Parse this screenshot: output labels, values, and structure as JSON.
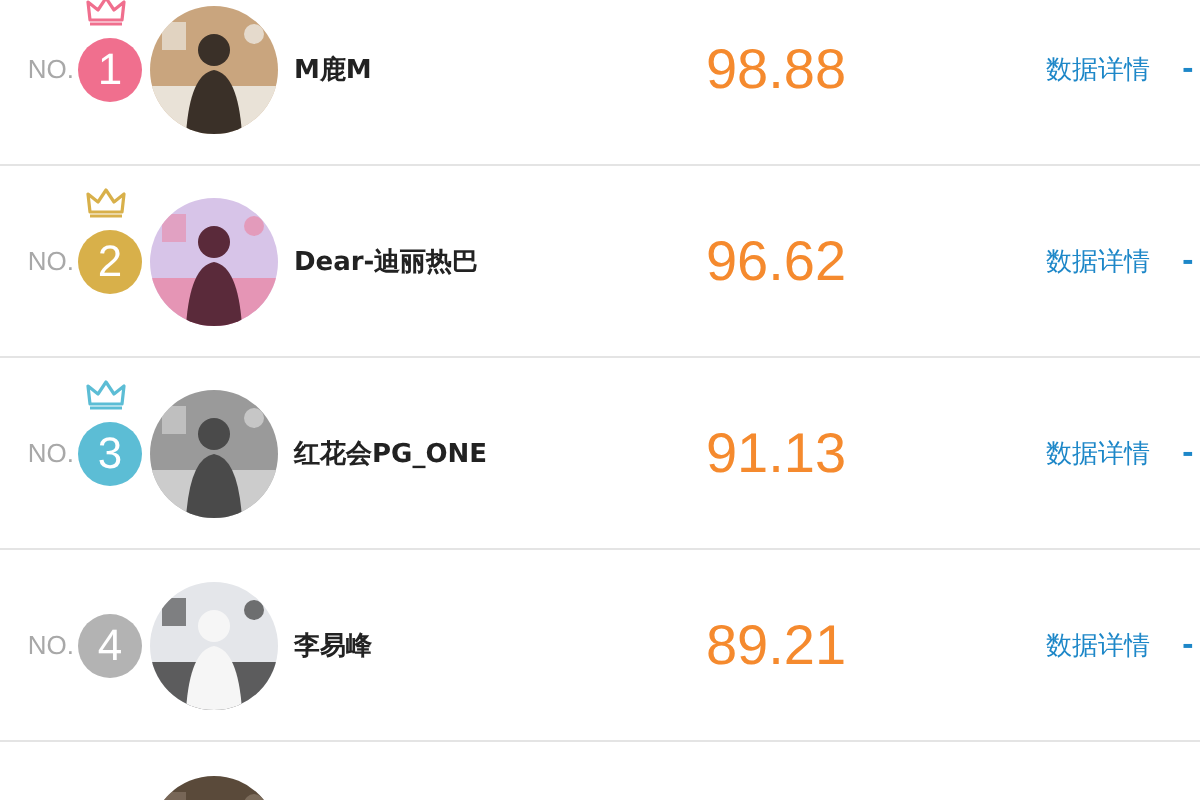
{
  "rows": [
    {
      "kind": "entry",
      "prefix": "NO.",
      "rank": "1",
      "color": "#f06f8e",
      "crown": true,
      "name": "M鹿M",
      "score": "98.88",
      "link": "数据详情",
      "trail": "-"
    },
    {
      "kind": "entry",
      "prefix": "NO.",
      "rank": "2",
      "color": "#d8b04a",
      "crown": true,
      "name": "Dear-迪丽热巴",
      "score": "96.62",
      "link": "数据详情",
      "trail": "-"
    },
    {
      "kind": "entry",
      "prefix": "NO.",
      "rank": "3",
      "color": "#5cbdd5",
      "crown": true,
      "name": "红花会PG_ONE",
      "score": "91.13",
      "link": "数据详情",
      "trail": "-"
    },
    {
      "kind": "entry",
      "prefix": "NO.",
      "rank": "4",
      "color": "#b3b3b3",
      "crown": false,
      "name": "李易峰",
      "score": "89.21",
      "link": "数据详情",
      "trail": "-"
    },
    {
      "kind": "partial"
    }
  ]
}
